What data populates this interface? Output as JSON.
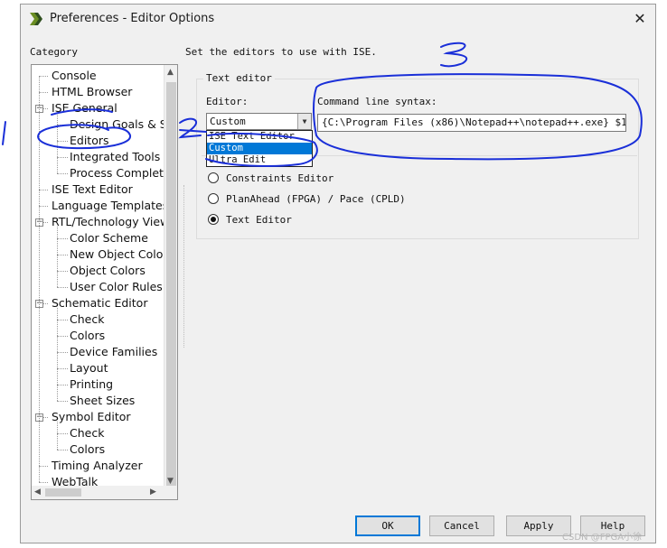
{
  "window": {
    "title": "Preferences - Editor Options",
    "close_glyph": "✕",
    "icon": "ise-app-icon"
  },
  "category": {
    "label": "Category",
    "items": [
      {
        "label": "Console",
        "level": 0
      },
      {
        "label": "HTML Browser",
        "level": 0
      },
      {
        "label": "ISE General",
        "level": 0,
        "expanded": true
      },
      {
        "label": "Design Goals & S",
        "level": 1
      },
      {
        "label": "Editors",
        "level": 1,
        "selected": true
      },
      {
        "label": "Integrated Tools",
        "level": 1
      },
      {
        "label": "Process Completi",
        "level": 1
      },
      {
        "label": "ISE Text Editor",
        "level": 0
      },
      {
        "label": "Language Templates",
        "level": 0
      },
      {
        "label": "RTL/Technology View",
        "level": 0,
        "expanded": true
      },
      {
        "label": "Color Scheme",
        "level": 1
      },
      {
        "label": "New Object Color",
        "level": 1
      },
      {
        "label": "Object Colors",
        "level": 1
      },
      {
        "label": "User Color Rules",
        "level": 1
      },
      {
        "label": "Schematic Editor",
        "level": 0,
        "expanded": true
      },
      {
        "label": "Check",
        "level": 1
      },
      {
        "label": "Colors",
        "level": 1
      },
      {
        "label": "Device Families",
        "level": 1
      },
      {
        "label": "Layout",
        "level": 1
      },
      {
        "label": "Printing",
        "level": 1
      },
      {
        "label": "Sheet Sizes",
        "level": 1
      },
      {
        "label": "Symbol Editor",
        "level": 0,
        "expanded": true
      },
      {
        "label": "Check",
        "level": 1
      },
      {
        "label": "Colors",
        "level": 1
      },
      {
        "label": "Timing Analyzer",
        "level": 0
      },
      {
        "label": "WebTalk",
        "level": 0
      }
    ]
  },
  "main": {
    "heading": "Set the editors to use with ISE.",
    "group_label": "Text editor",
    "editor_label": "Editor:",
    "editor_value": "Custom",
    "editor_options": [
      "ISE Text Editor",
      "Custom",
      "Ultra Edit"
    ],
    "editor_selected_option": "Custom",
    "cmd_label": "Command line syntax:",
    "cmd_value": "{C:\\Program Files (x86)\\Notepad++\\notepad++.exe} $1",
    "radios": [
      {
        "label": "Constraints Editor",
        "checked": false
      },
      {
        "label": "PlanAhead (FPGA) / Pace (CPLD)",
        "checked": false
      },
      {
        "label": "Text Editor",
        "checked": true
      }
    ]
  },
  "buttons": {
    "ok": "OK",
    "cancel": "Cancel",
    "apply": "Apply",
    "help": "Help"
  },
  "annotations": {
    "marks": [
      "1",
      "2",
      "3"
    ],
    "color": "#1a2fd8"
  },
  "watermark": "CSDN @FPGA小徐"
}
